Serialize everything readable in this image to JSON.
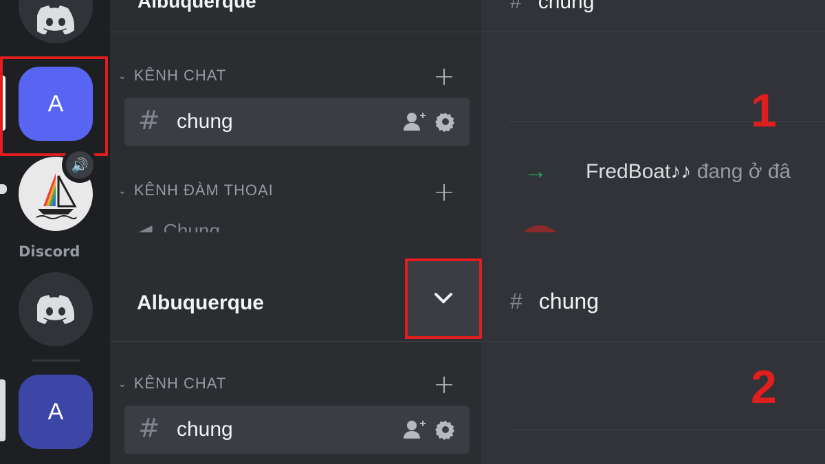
{
  "panel1": {
    "server_name_top": "Albuquerque",
    "channel_header_top": "chung",
    "server_avatar_letter": "A",
    "category_text": "KÊNH CHAT",
    "channel_name": "chung",
    "category_voice": "KÊNH ĐÀM THOẠI",
    "voice_channel_partial": "Chung",
    "system_message_user": "FredBoat♪♪",
    "system_message_text": "đang ở đâ",
    "step_number": "1"
  },
  "panel2": {
    "app_label": "Discord",
    "server_name": "Albuquerque",
    "channel_header": "chung",
    "server_avatar_letter": "A",
    "category_text": "KÊNH CHAT",
    "channel_name": "chung",
    "step_number": "2"
  },
  "colors": {
    "highlight_red": "#e01e1e",
    "blurple": "#5865f2",
    "join_arrow": "#23a55a"
  },
  "icons": [
    "discord-logo-icon",
    "hash-icon",
    "add-member-icon",
    "gear-icon",
    "chevron-down-icon",
    "plus-icon",
    "speaker-icon",
    "arrow-right-icon"
  ]
}
